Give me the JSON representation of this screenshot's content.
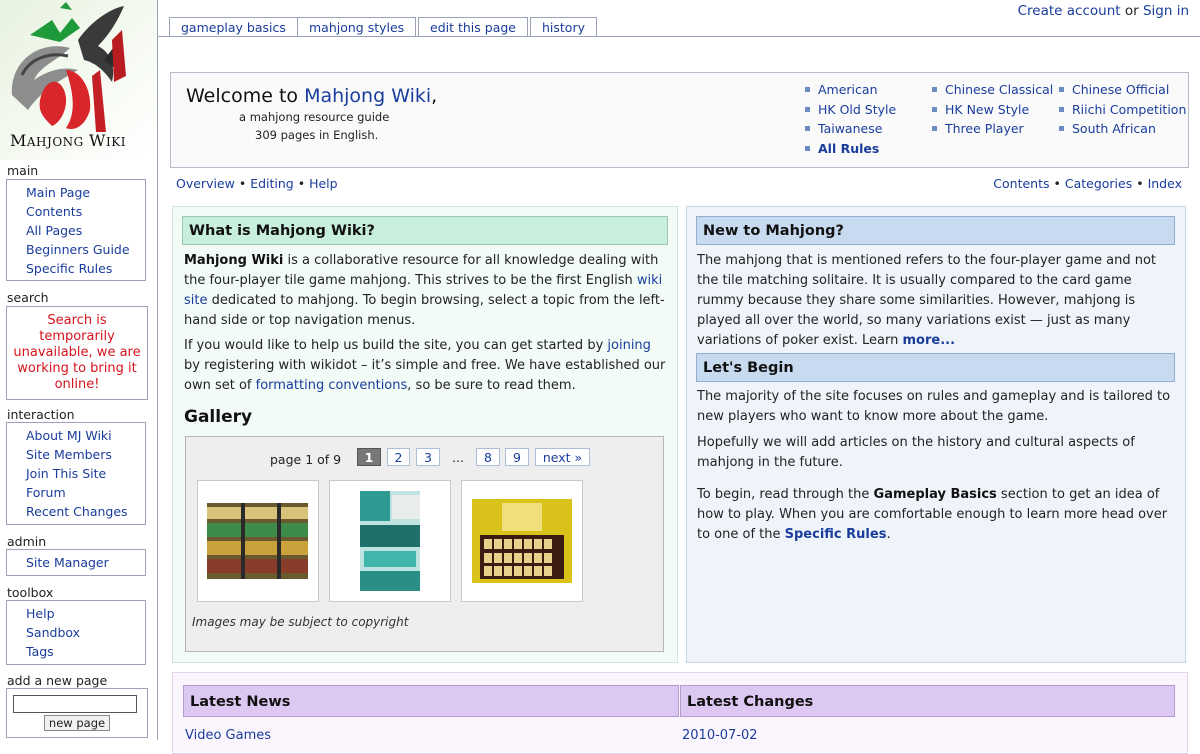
{
  "site": {
    "logo_text": "Mahjong Wiki"
  },
  "top_links": {
    "create_account": "Create account",
    "or": "or",
    "sign_in": "Sign in"
  },
  "tabs": [
    "gameplay basics",
    "mahjong styles",
    "edit this page",
    "history"
  ],
  "sidebar": {
    "main": {
      "heading": "main",
      "items": [
        "Main Page",
        "Contents",
        "All Pages",
        "Beginners Guide",
        "Specific Rules"
      ]
    },
    "search": {
      "heading": "search",
      "message": "Search is temporarily unavailable, we are working to bring it online!"
    },
    "interaction": {
      "heading": "interaction",
      "items": [
        "About MJ Wiki",
        "Site Members",
        "Join This Site",
        "Forum",
        "Recent Changes"
      ]
    },
    "admin": {
      "heading": "admin",
      "items": [
        "Site Manager"
      ]
    },
    "toolbox": {
      "heading": "toolbox",
      "items": [
        "Help",
        "Sandbox",
        "Tags"
      ]
    },
    "new_page": {
      "heading": "add a new page",
      "input_value": "",
      "button": "new page"
    }
  },
  "welcome": {
    "title_prefix": "Welcome to ",
    "title_link": "Mahjong Wiki",
    "title_suffix": ",",
    "subtitle": "a mahjong resource guide",
    "page_count": "309 pages in English.",
    "styles": [
      "American",
      "HK Old Style",
      "Taiwanese",
      "All Rules",
      "Chinese Classical",
      "HK New Style",
      "Three Player",
      "Chinese Official",
      "Riichi Competition",
      "South African"
    ]
  },
  "subnav_left": [
    "Overview",
    "Editing",
    "Help"
  ],
  "subnav_right": [
    "Contents",
    "Categories",
    "Index"
  ],
  "subnav_sep": " • ",
  "what_is": {
    "heading": "What is Mahjong Wiki?",
    "p1": {
      "bold": "Mahjong Wiki",
      "t1": " is a collaborative resource for all knowledge dealing with the four-player tile game mahjong. This strives to be the first English ",
      "link": "wiki site",
      "t2": " dedicated to mahjong. To begin browsing, select a topic from the left-hand side or top navigation menus."
    },
    "p2": {
      "t1": "If you would like to help us build the site, you can get started by ",
      "link1": "joining",
      "t2": " by registering with wikidot – it’s simple and free. We have established our own set of ",
      "link2": "formatting conventions",
      "t3": ", so be sure to read them."
    }
  },
  "gallery": {
    "title": "Gallery",
    "pager_text": "page 1 of 9",
    "pages": [
      "1",
      "2",
      "3",
      "...",
      "8",
      "9",
      "next »"
    ],
    "note": "Images may be subject to copyright"
  },
  "new_to": {
    "heading": "New to Mahjong?",
    "text": "The mahjong that is mentioned refers to the four-player game and not the tile matching solitaire. It is usually compared to the card game rummy because they share some similarities. However, mahjong is played all over the world, so many variations exist — just as many variations of poker exist. Learn ",
    "link": "more..."
  },
  "begin": {
    "heading": "Let's Begin",
    "p1": "The majority of the site focuses on rules and gameplay and is tailored to new players who want to know more about the game.",
    "p2": "Hopefully we will add articles on the history and cultural aspects of mahjong in the future.",
    "p3": {
      "t1": "To begin, read through the ",
      "bold": "Gameplay Basics",
      "t2": " section to get an idea of how to play. When you are comfortable enough to learn more head over to one of the ",
      "link": "Specific Rules",
      "t3": "."
    }
  },
  "news": {
    "heading": "Latest News",
    "first_item": "Video Games"
  },
  "changes": {
    "heading": "Latest Changes",
    "first_item": "2010-07-02"
  },
  "colors": {
    "link": "#1a3d9c",
    "search_error": "#d4141b",
    "green_head": "#c8eedd",
    "blue_head": "#c8daf0",
    "purple_head": "#dcc8f0"
  }
}
